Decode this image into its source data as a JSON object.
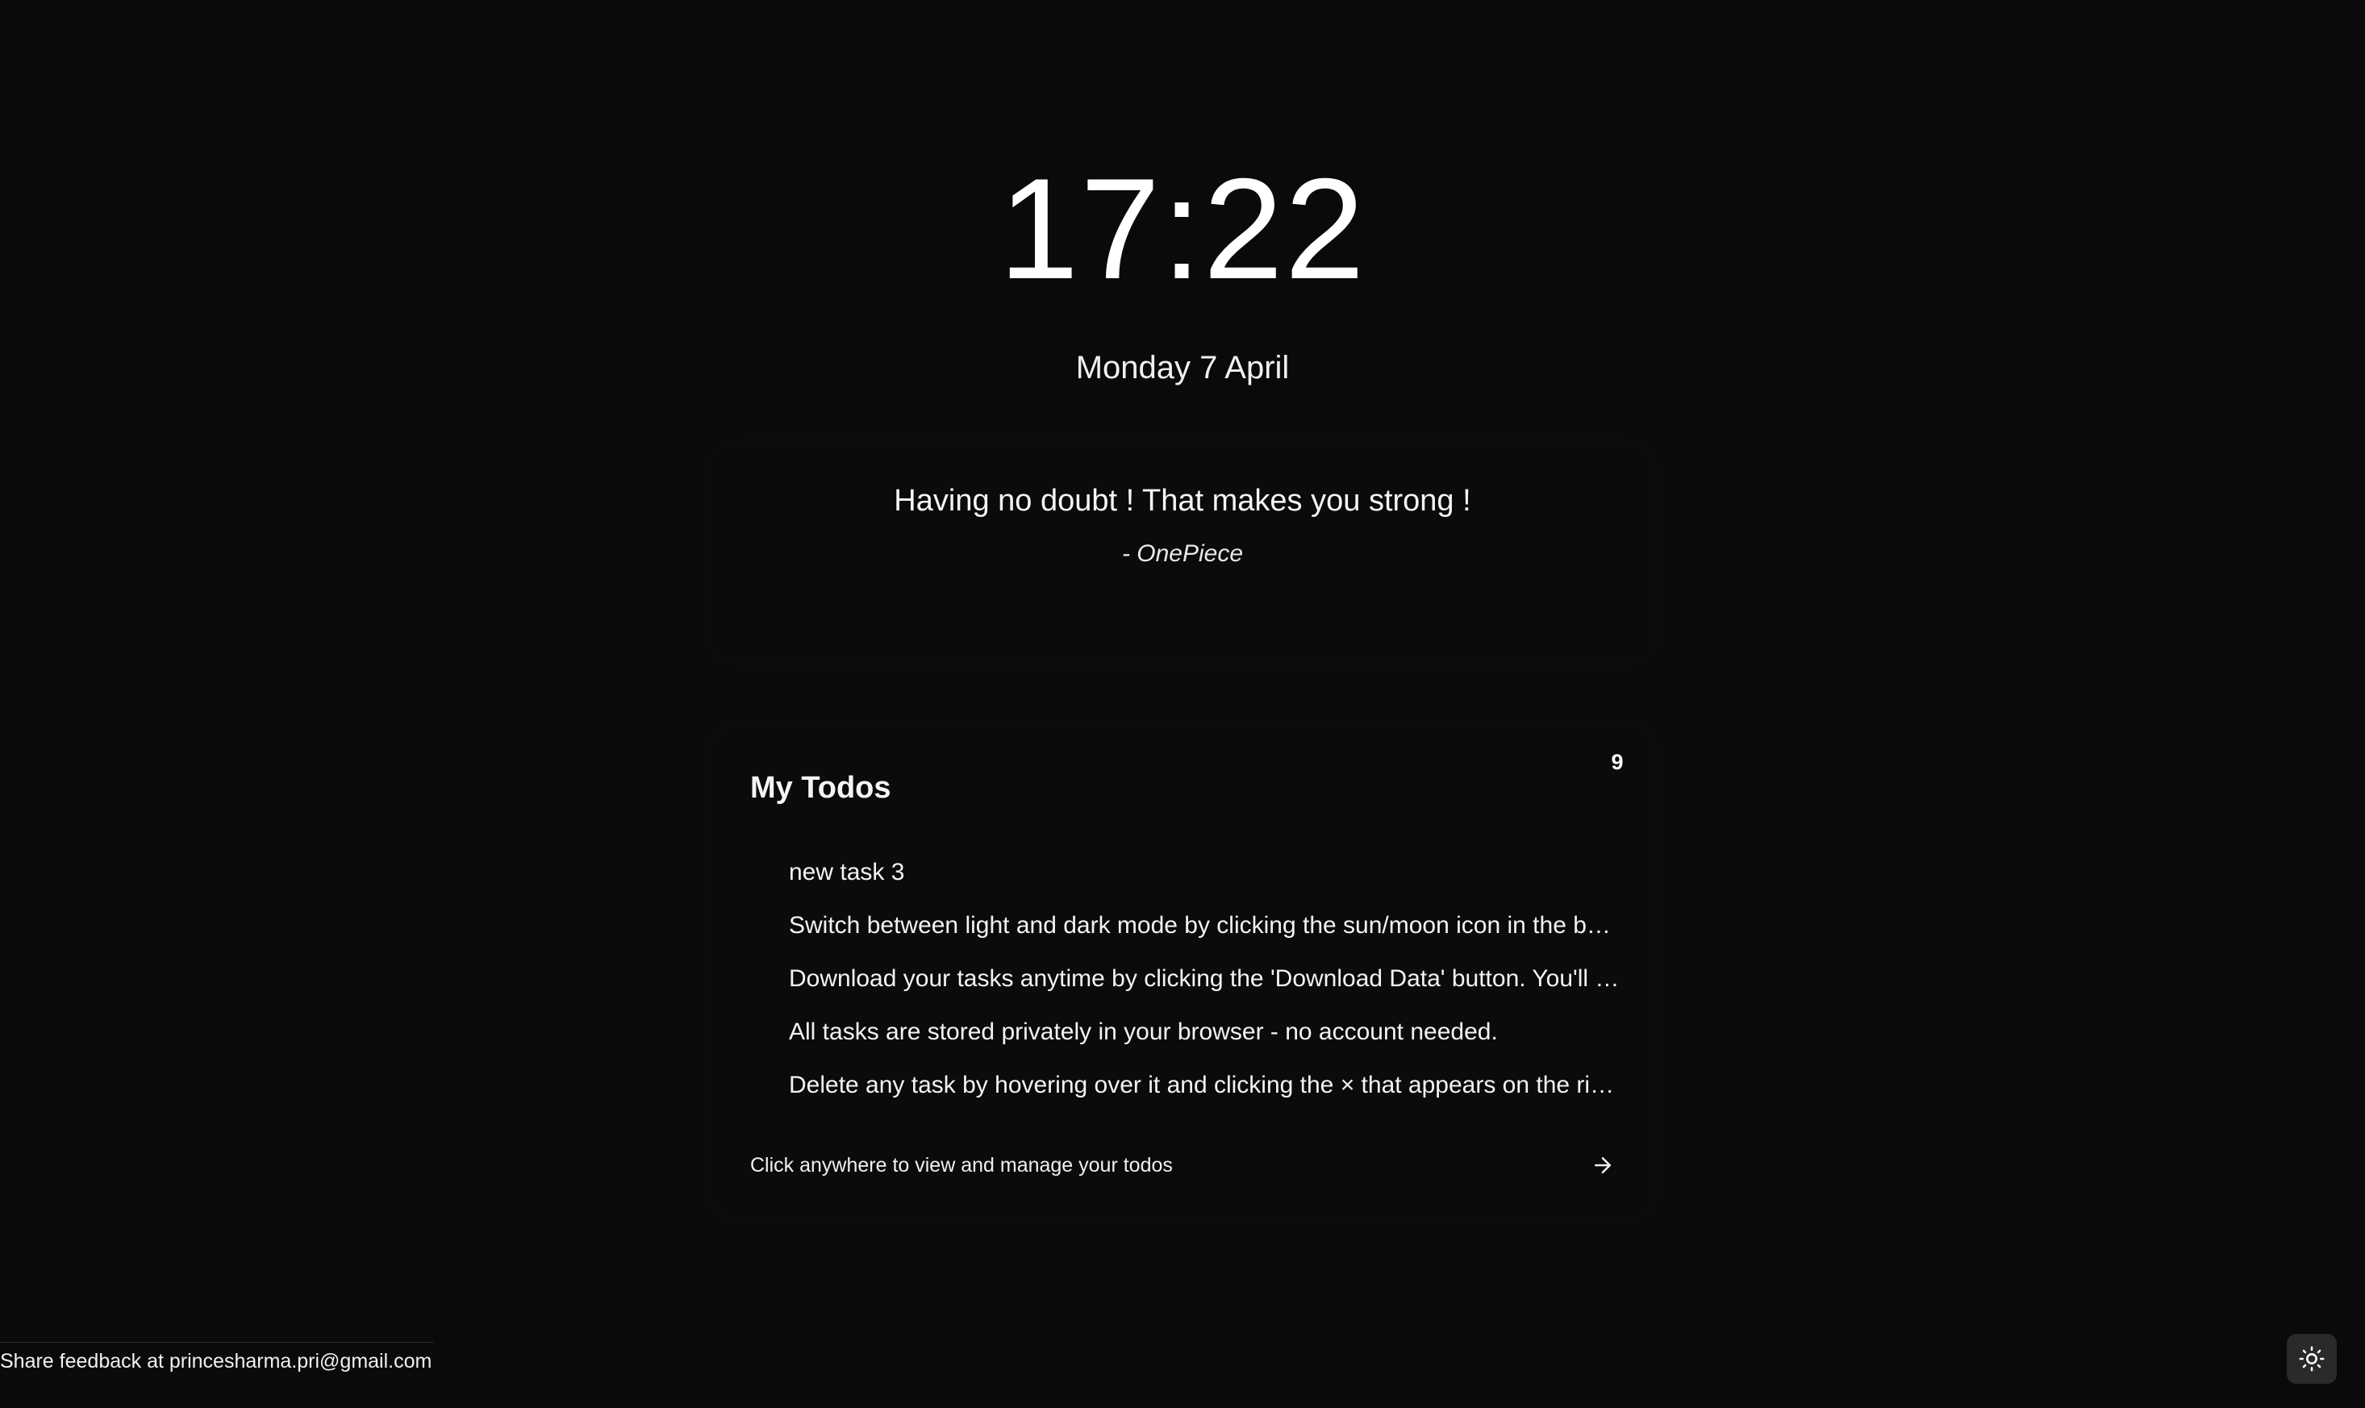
{
  "clock": {
    "time": "17:22"
  },
  "date": {
    "text": "Monday 7 April"
  },
  "quote": {
    "text": "Having no doubt ! That makes you strong !",
    "author": "- OnePiece"
  },
  "todos": {
    "title": "My Todos",
    "count": "9",
    "items": [
      {
        "text": "new task 3"
      },
      {
        "text": "Switch between light and dark mode by clicking the sun/moon icon in the bott..."
      },
      {
        "text": "Download your tasks anytime by clicking the 'Download Data' button. You'll g..."
      },
      {
        "text": "All tasks are stored privately in your browser - no account needed."
      },
      {
        "text": "Delete any task by hovering over it and clicking the × that appears on the right."
      }
    ],
    "footer_text": "Click anywhere to view and manage your todos",
    "footer_icon": "arrow-right-icon"
  },
  "feedback": {
    "text": "Share feedback at princesharma.pri@gmail.com"
  },
  "theme_toggle": {
    "icon": "sun-icon"
  }
}
